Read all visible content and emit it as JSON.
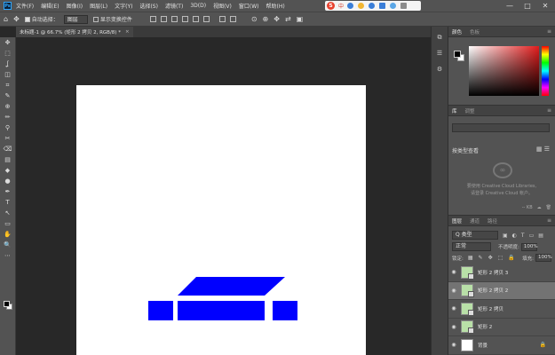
{
  "app": {
    "logo_text": "Ps"
  },
  "menu": [
    "文件(F)",
    "编辑(E)",
    "图像(I)",
    "图层(L)",
    "文字(Y)",
    "选择(S)",
    "滤镜(T)",
    "3D(D)",
    "视图(V)",
    "窗口(W)",
    "帮助(H)"
  ],
  "ime": {
    "logo": "S",
    "mode": "中"
  },
  "window_controls": {
    "minimize": "—",
    "maximize": "□",
    "close": "✕"
  },
  "options_bar": {
    "auto_select_label": "自动选择：",
    "auto_select_value": "图层",
    "transform_label": "显示变换控件"
  },
  "document_tab": {
    "title": "未标题-1 @ 66.7% (矩形 2 拷贝 2, RGB/8) *",
    "close": "×"
  },
  "tools": [
    "✥",
    "⬚",
    "ʆ",
    "◫",
    "⌗",
    "✎",
    "⊕",
    "✏",
    "⚲",
    "✂",
    "⌫",
    "▤",
    "◆",
    "●",
    "✒",
    "T",
    "↖",
    "▭",
    "✋",
    "🔍",
    "⋯"
  ],
  "color_panel": {
    "tabs": [
      "颜色",
      "色板"
    ]
  },
  "libraries_panel": {
    "tabs": [
      "库",
      "调整"
    ],
    "search_placeholder": "",
    "group_label": "按类型查看",
    "message_line1": "要使用 Creative Cloud Libraries,",
    "message_line2": "请登录 Creative Cloud 帐户。",
    "footer_size": "-- KB"
  },
  "layers_panel": {
    "tabs": [
      "图层",
      "通道",
      "路径"
    ],
    "kind_filter": "Q 类型",
    "blend_mode": "正常",
    "opacity_label": "不透明度:",
    "opacity_value": "100%",
    "lock_label": "锁定:",
    "fill_label": "填充:",
    "fill_value": "100%",
    "layers": [
      {
        "name": "矩形 2 拷贝 3",
        "selected": false
      },
      {
        "name": "矩形 2 拷贝 2",
        "selected": true
      },
      {
        "name": "矩形 2 拷贝",
        "selected": false
      },
      {
        "name": "矩形 2",
        "selected": false
      },
      {
        "name": "背景",
        "selected": false,
        "locked": true
      }
    ]
  },
  "artwork": {
    "shape_color": "#0000ff"
  }
}
